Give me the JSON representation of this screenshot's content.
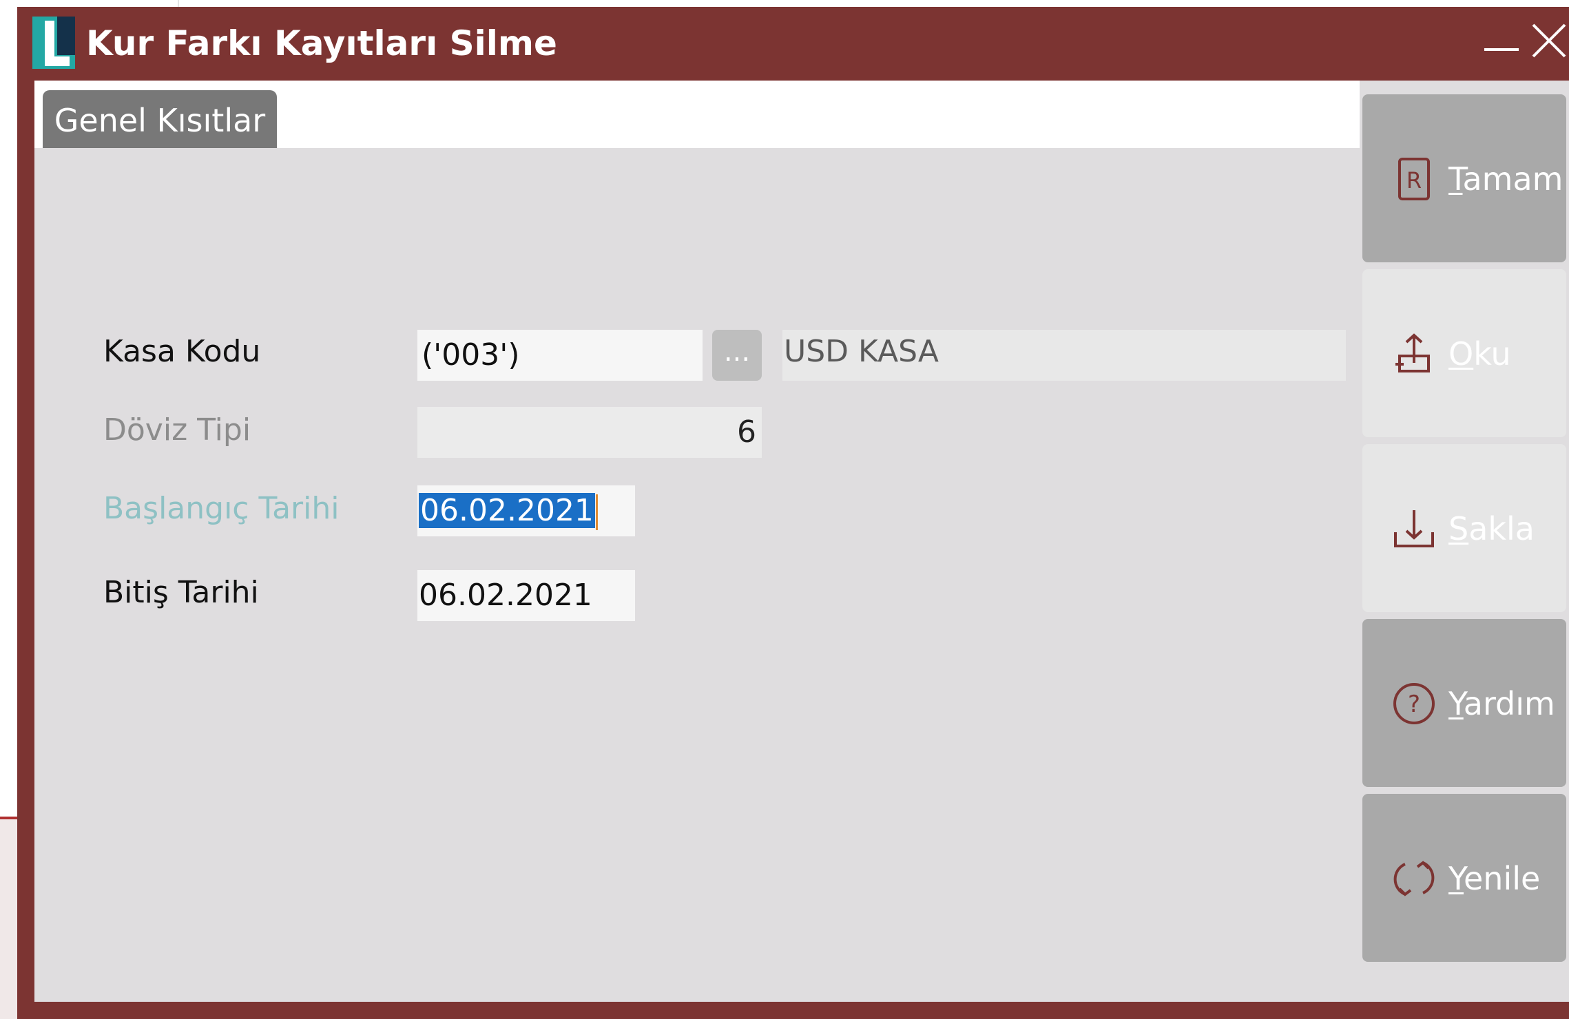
{
  "window": {
    "title": "Kur Farkı Kayıtları Silme"
  },
  "tabs": [
    {
      "label": "Genel Kısıtlar"
    }
  ],
  "form": {
    "kasa_kodu": {
      "label": "Kasa Kodu",
      "value": "('003')",
      "lookup_label": "...",
      "description": "USD KASA"
    },
    "doviz_tipi": {
      "label": "Döviz Tipi",
      "value": "6"
    },
    "baslangic_tarihi": {
      "label": "Başlangıç Tarihi",
      "value": "06.02.2021"
    },
    "bitis_tarihi": {
      "label": "Bitiş Tarihi",
      "value": "06.02.2021"
    }
  },
  "side_buttons": [
    {
      "accel": "T",
      "rest": "amam",
      "icon": "report-icon",
      "enabled": true
    },
    {
      "accel": "O",
      "rest": "ku",
      "icon": "upload-icon",
      "enabled": false
    },
    {
      "accel": "S",
      "rest": "akla",
      "icon": "download-icon",
      "enabled": false
    },
    {
      "accel": "Y",
      "rest": "ardım",
      "icon": "help-icon",
      "enabled": true
    },
    {
      "accel": "Y",
      "rest": "enile",
      "icon": "refresh-icon",
      "enabled": true
    }
  ],
  "colors": {
    "titlebar": "#7c3432",
    "accent_teal": "#23a8a4",
    "selection": "#1a6fc6",
    "icon_red": "#7c3432"
  }
}
